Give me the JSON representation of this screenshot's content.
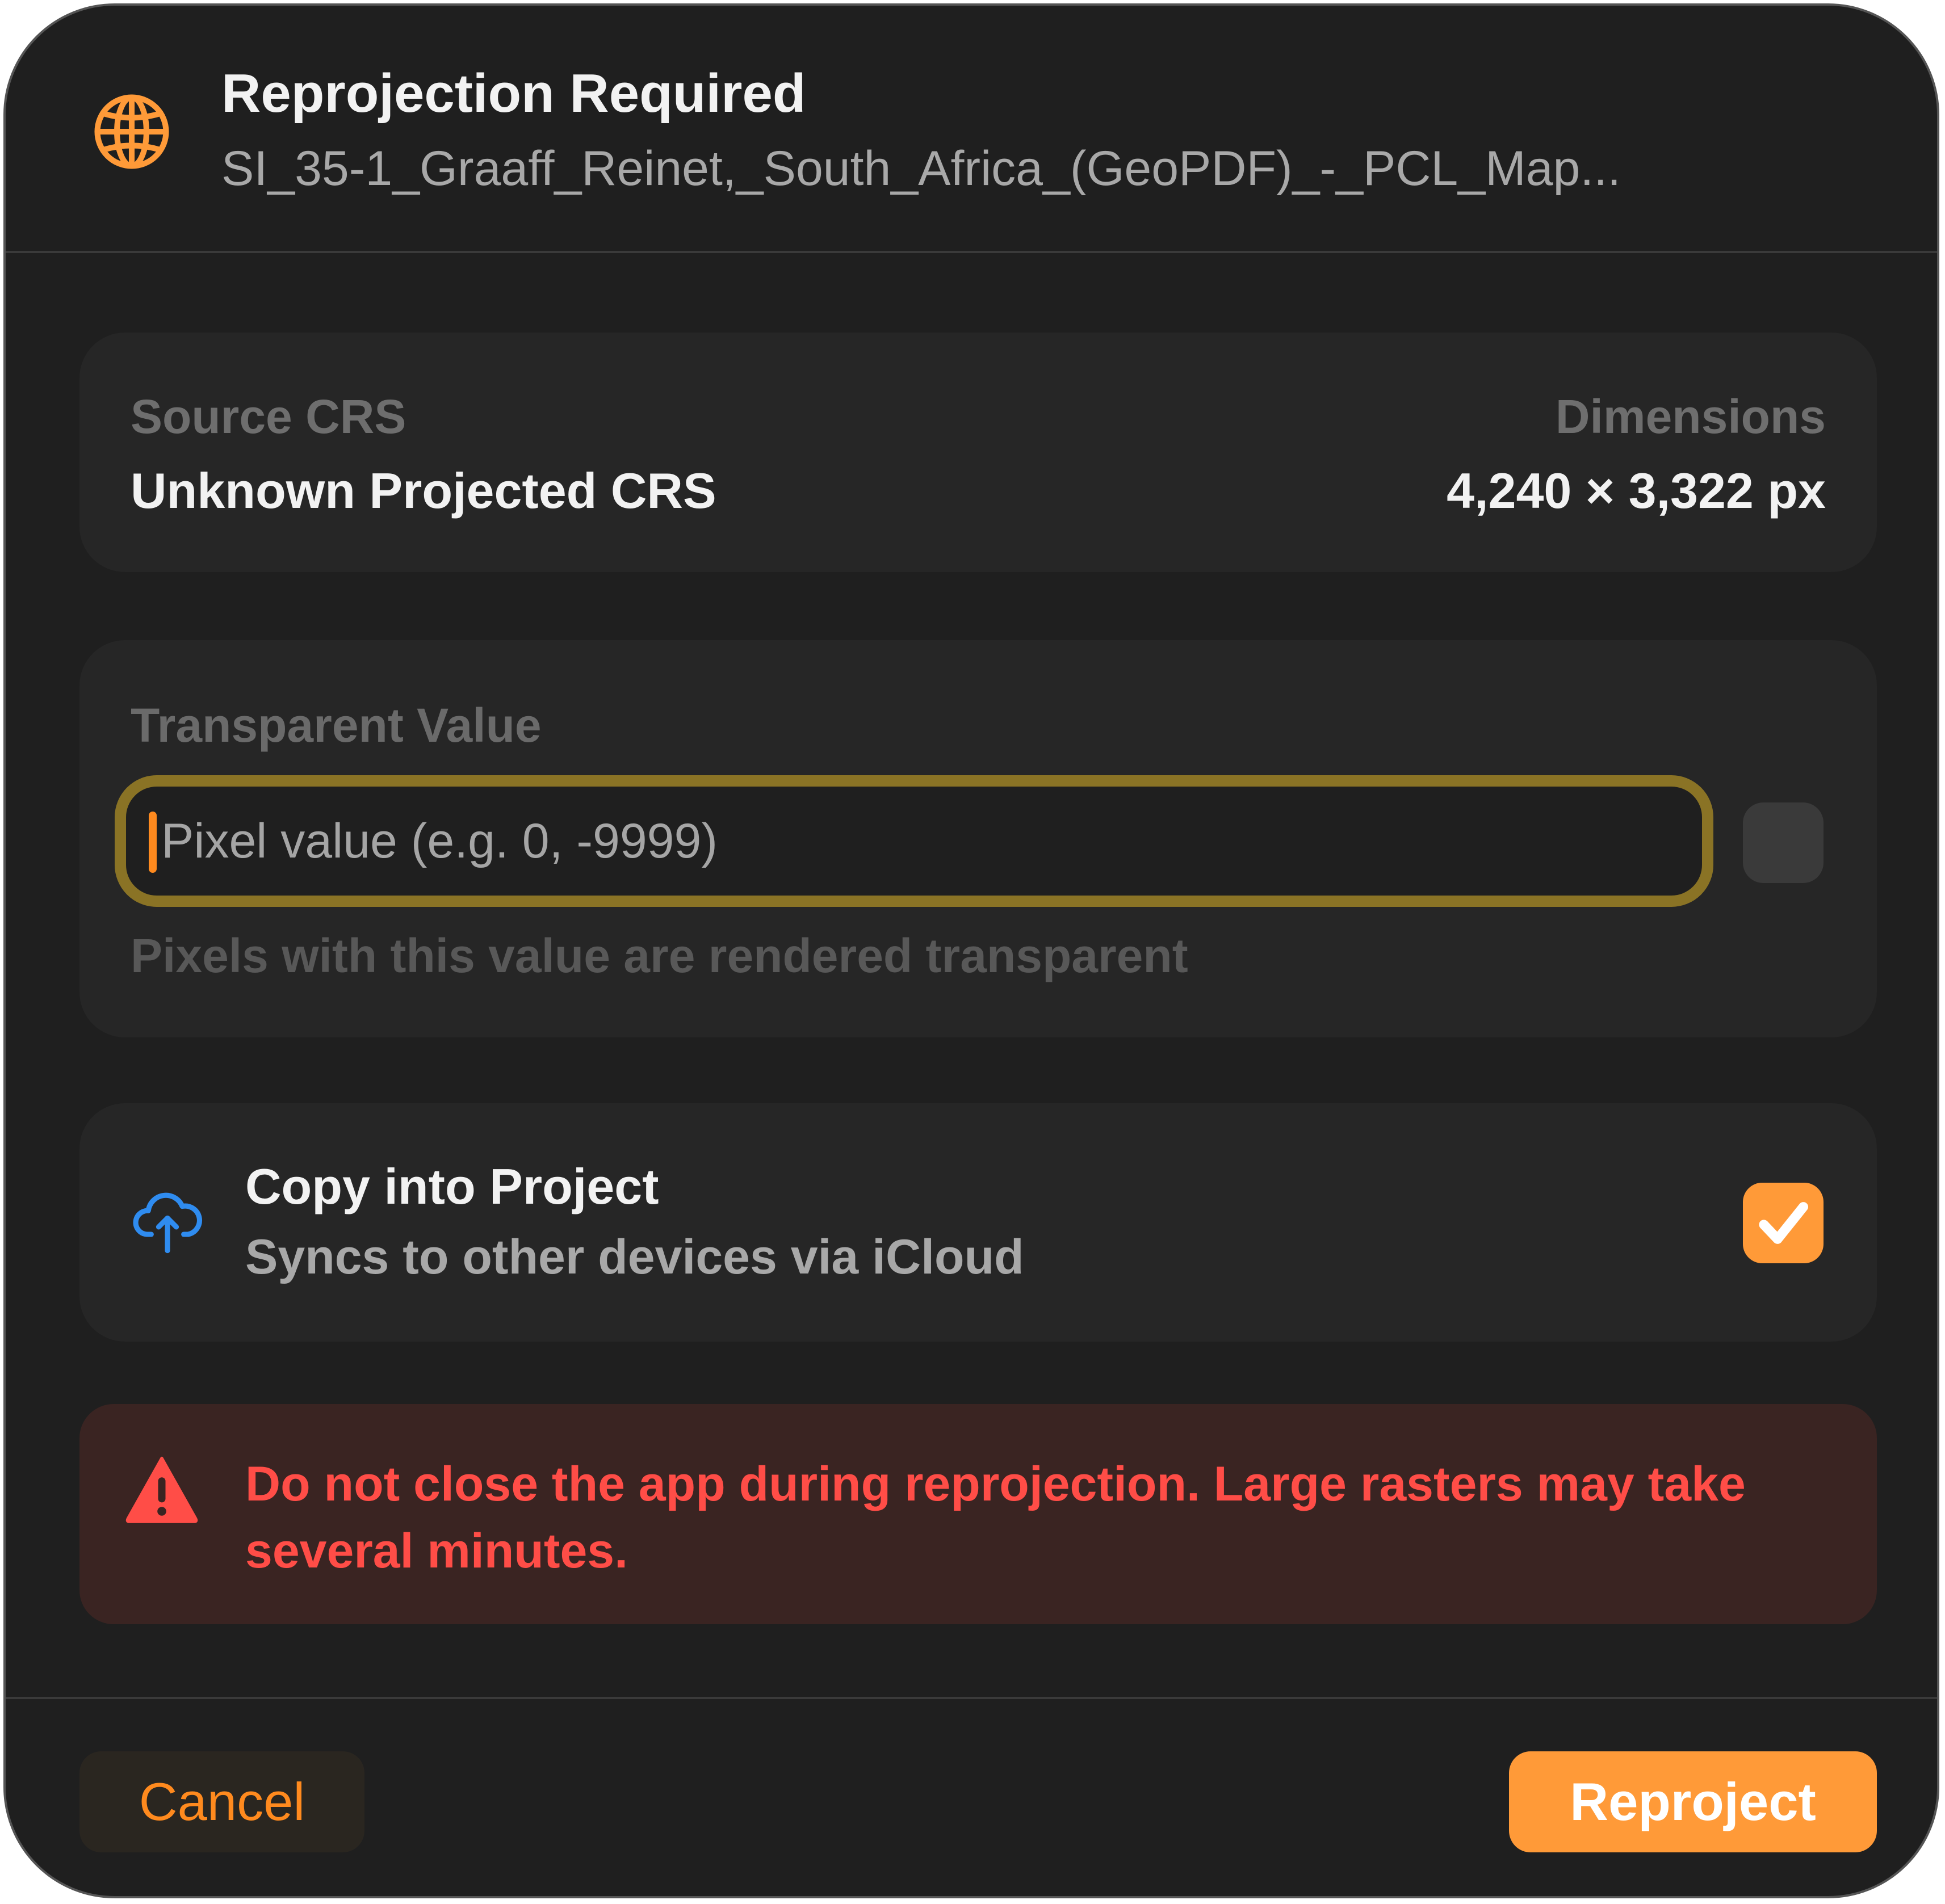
{
  "header": {
    "icon": "globe-icon",
    "title": "Reprojection Required",
    "subtitle": "SI_35-1_Graaff_Reinet,_South_Africa_(GeoPDF)_-_PCL_Map..."
  },
  "info": {
    "source_crs_label": "Source CRS",
    "source_crs_value": "Unknown Projected CRS",
    "dimensions_label": "Dimensions",
    "dimensions_value": "4,240 × 3,322 px"
  },
  "transparent": {
    "label": "Transparent Value",
    "input_value": "",
    "placeholder": "Pixel value (e.g. 0, -9999)",
    "toggle_checked": false,
    "help": "Pixels with this value are rendered transparent"
  },
  "copy": {
    "icon": "cloud-upload-icon",
    "title": "Copy into Project",
    "subtitle": "Syncs to other devices via iCloud",
    "checked": true
  },
  "warning": {
    "icon": "warning-triangle-icon",
    "text": "Do not close the app during reprojection. Large rasters may take several minutes."
  },
  "footer": {
    "cancel_label": "Cancel",
    "reproject_label": "Reproject"
  },
  "colors": {
    "accent": "#ff9a38",
    "warning": "#ff4d47",
    "background": "#1f1f1f",
    "card": "#262626",
    "cloud_icon": "#2f8cf0"
  }
}
